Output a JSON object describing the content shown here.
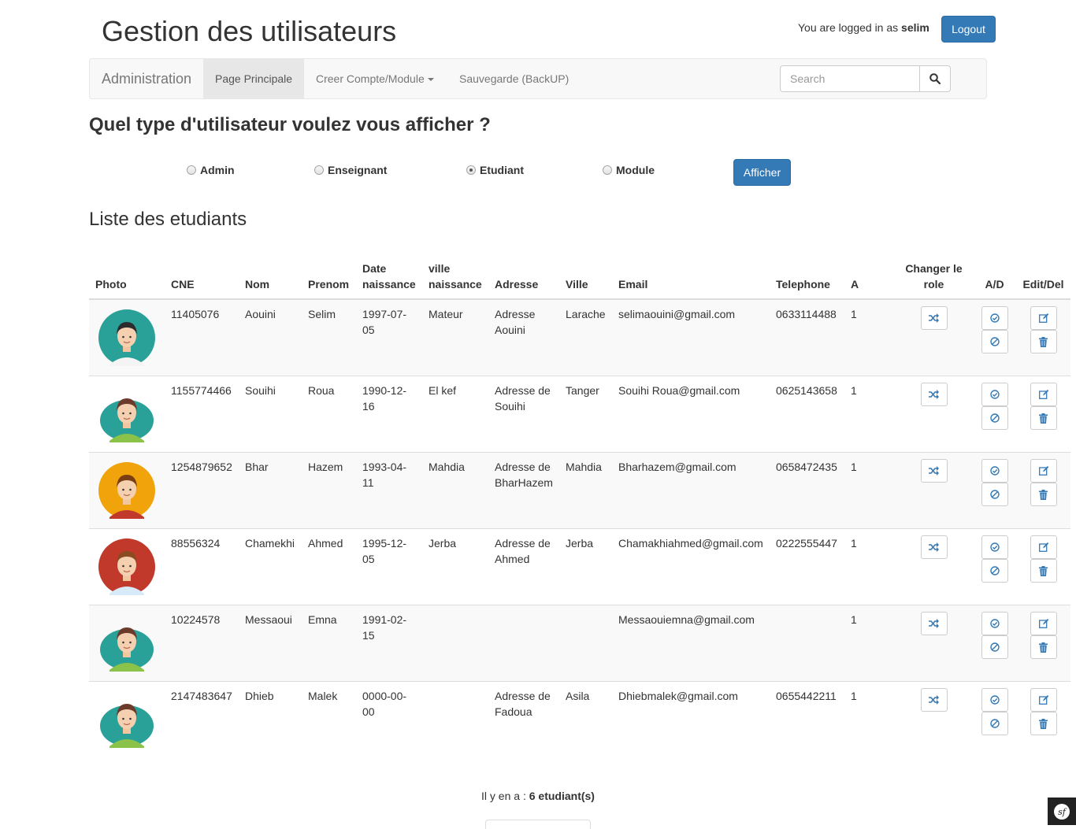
{
  "header": {
    "title": "Gestion des utilisateurs",
    "logged_prefix": "You are logged in as ",
    "username": "selim",
    "logout_label": "Logout"
  },
  "navbar": {
    "brand": "Administration",
    "items": [
      {
        "label": "Page Principale",
        "active": true
      },
      {
        "label": "Creer Compte/Module",
        "dropdown": true
      },
      {
        "label": "Sauvegarde (BackUP)"
      }
    ],
    "search_placeholder": "Search",
    "search_icon": "search-icon"
  },
  "filter": {
    "question": "Quel type d'utilisateur voulez vous afficher ?",
    "options": [
      {
        "label": "Admin",
        "checked": false
      },
      {
        "label": "Enseignant",
        "checked": false
      },
      {
        "label": "Etudiant",
        "checked": true
      },
      {
        "label": "Module",
        "checked": false
      }
    ],
    "submit_label": "Afficher"
  },
  "list": {
    "title": "Liste des etudiants",
    "headers": {
      "photo": "Photo",
      "cne": "CNE",
      "nom": "Nom",
      "prenom": "Prenom",
      "date_naissance": "Date naissance",
      "ville_naissance": "ville naissance",
      "adresse": "Adresse",
      "ville": "Ville",
      "email": "Email",
      "telephone": "Telephone",
      "a": "A",
      "changer_role": "Changer le role",
      "ad": "A/D",
      "edit_del": "Edit/Del"
    },
    "rows": [
      {
        "avatar": "male-dark-hair-avatar",
        "avatar_bg": "#2aa198",
        "cne": "11405076",
        "nom": "Aouini",
        "prenom": "Selim",
        "date": "1997-07-05",
        "ville_naissance": "Mateur",
        "adresse": "Adresse Aouini",
        "ville": "Larache",
        "email": "selimaouini@gmail.com",
        "telephone": "0633114488",
        "a": "1"
      },
      {
        "avatar": "female-avatar",
        "avatar_bg": "#2aa198",
        "cne": "1155774466",
        "nom": "Souihi",
        "prenom": "Roua",
        "date": "1990-12-16",
        "ville_naissance": "El kef",
        "adresse": "Adresse de Souihi",
        "ville": "Tanger",
        "email": "Souihi Roua@gmail.com",
        "telephone": "0625143658",
        "a": "1"
      },
      {
        "avatar": "male-spiky-hair-avatar",
        "avatar_bg": "#f0a30a",
        "cne": "1254879652",
        "nom": "Bhar",
        "prenom": "Hazem",
        "date": "1993-04-11",
        "ville_naissance": "Mahdia",
        "adresse": "Adresse de BharHazem",
        "ville": "Mahdia",
        "email": "Bharhazem@gmail.com",
        "telephone": "0658472435",
        "a": "1"
      },
      {
        "avatar": "male-brown-hair-avatar",
        "avatar_bg": "#c0392b",
        "cne": "88556324",
        "nom": "Chamekhi",
        "prenom": "Ahmed",
        "date": "1995-12-05",
        "ville_naissance": "Jerba",
        "adresse": "Adresse de Ahmed",
        "ville": "Jerba",
        "email": "Chamakhiahmed@gmail.com",
        "telephone": "0222555447",
        "a": "1"
      },
      {
        "avatar": "female-avatar",
        "avatar_bg": "#2aa198",
        "cne": "10224578",
        "nom": "Messaoui",
        "prenom": "Emna",
        "date": "1991-02-15",
        "ville_naissance": "",
        "adresse": "",
        "ville": "",
        "email": "Messaouiemna@gmail.com",
        "telephone": "",
        "a": "1"
      },
      {
        "avatar": "female-avatar",
        "avatar_bg": "#2aa198",
        "cne": "2147483647",
        "nom": "Dhieb",
        "prenom": "Malek",
        "date": "0000-00-00",
        "ville_naissance": "",
        "adresse": "Adresse de Fadoua",
        "ville": "Asila",
        "email": "Dhiebmalek@gmail.com",
        "telephone": "0655442211",
        "a": "1"
      }
    ]
  },
  "footer": {
    "count_prefix": "Il y en a : ",
    "count_value": "6 etudiant(s)"
  },
  "colors": {
    "primary": "#337ab7",
    "icon_blue": "#337ab7"
  }
}
